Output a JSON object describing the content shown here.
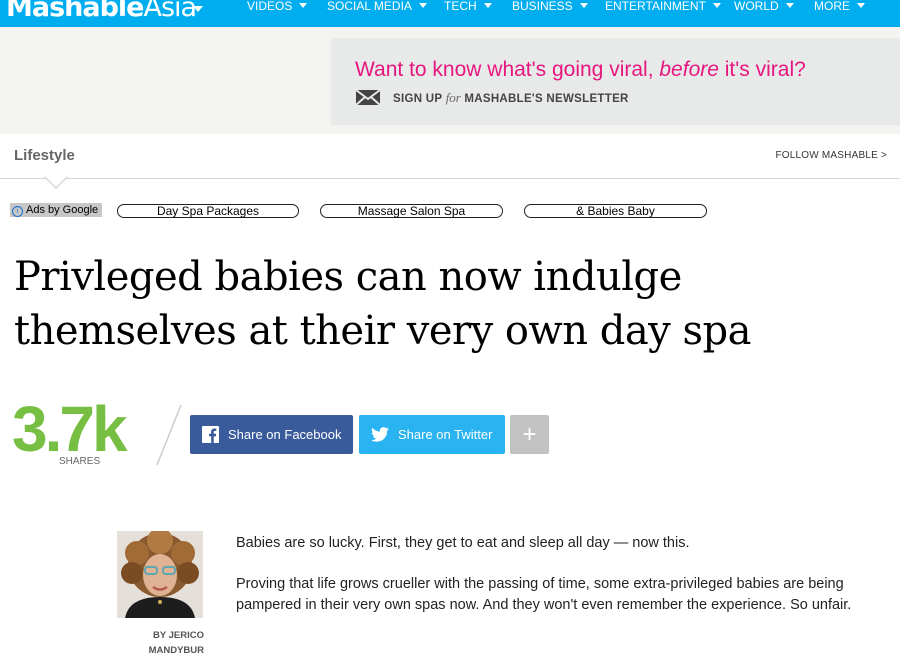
{
  "site": {
    "logo_main": "Mashable",
    "logo_suffix": "Asia"
  },
  "nav": {
    "items": [
      {
        "label": "VIDEOS"
      },
      {
        "label": "SOCIAL MEDIA"
      },
      {
        "label": "TECH"
      },
      {
        "label": "BUSINESS"
      },
      {
        "label": "ENTERTAINMENT"
      },
      {
        "label": "WORLD"
      },
      {
        "label": "MORE"
      }
    ]
  },
  "newsletter": {
    "headline_pre": "Want to know what's going viral, ",
    "headline_em": "before",
    "headline_post": " it's viral?",
    "signup": "SIGN UP",
    "for": "for",
    "signup_post": "MASHABLE'S NEWSLETTER"
  },
  "section": {
    "title": "Lifestyle",
    "follow": "FOLLOW MASHABLE >"
  },
  "ads": {
    "label": "Ads by Google",
    "links": [
      "Day Spa Packages",
      "Massage Salon Spa",
      "& Babies Baby"
    ]
  },
  "article": {
    "headline": "Privleged babies can now indulge themselves at their very own day spa",
    "share_count": "3.7k",
    "share_label": "SHARES",
    "facebook_label": "Share on Facebook",
    "twitter_label": "Share on Twitter",
    "more_label": "+",
    "byline_line1": "BY JERICO",
    "byline_line2": "MANDYBUR",
    "paragraphs": [
      "Babies are so lucky. First, they get to eat and sleep all day — now this.",
      "Proving that life grows crueller with the passing of time, some extra-privileged babies are being pampered in their very own spas now. And they won't even remember the experience. So unfair."
    ]
  },
  "colors": {
    "nav_bg": "#00aeef",
    "brand_pink": "#e6167e",
    "share_green": "#77bf43",
    "facebook": "#3a5b9b",
    "twitter": "#29b3f0"
  }
}
